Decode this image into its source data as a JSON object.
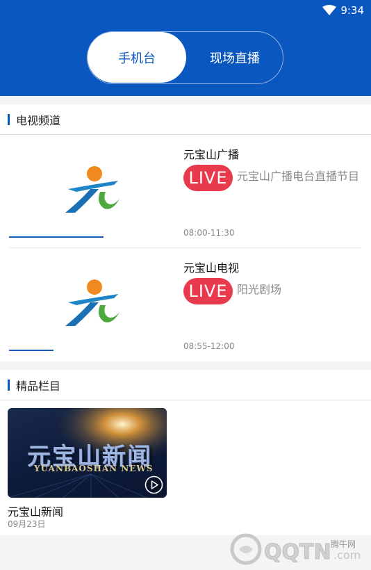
{
  "status_bar": {
    "time": "9:34",
    "icon": "wifi-icon"
  },
  "tabs": {
    "active": "手机台",
    "other": "现场直播"
  },
  "tv_section": {
    "title": "电视频道",
    "channels": [
      {
        "name": "元宝山广播",
        "live_badge": "LIVE",
        "program": "元宝山广播电台直播节目",
        "time": "08:00-11:30",
        "progress": 0.45
      },
      {
        "name": "元宝山电视",
        "live_badge": "LIVE",
        "program": "阳光剧场",
        "time": "08:55-12:00",
        "progress": 0.21
      }
    ]
  },
  "featured_section": {
    "title": "精品栏目",
    "items": [
      {
        "thumb_title": "元宝山新闻",
        "thumb_subtitle": "YUANBAOSHAN NEWS",
        "name": "元宝山新闻",
        "date": "09月23日"
      }
    ]
  },
  "watermark": {
    "site": "腾牛网",
    "brand": "QQTN.com"
  },
  "colors": {
    "brand_blue": "#0a57c0",
    "live_red": "#e83a4c"
  }
}
